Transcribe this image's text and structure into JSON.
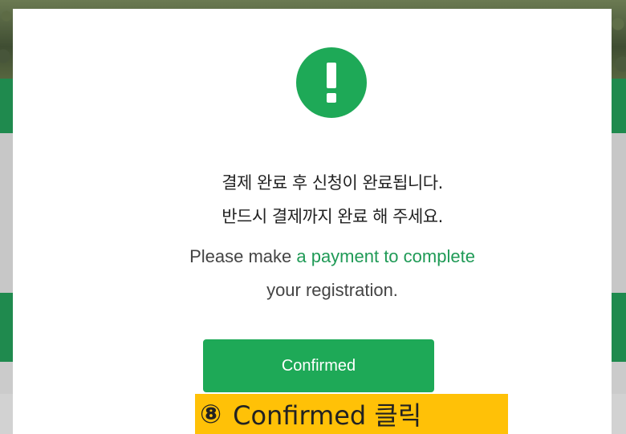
{
  "modal": {
    "icon": "exclamation-icon",
    "message_ko_line1": "결제 완료 후 신청이 완료됩니다.",
    "message_ko_line2": "반드시 결제까지 완료 해 주세요.",
    "message_en_prefix": "Please make ",
    "message_en_accent": "a payment to complete",
    "message_en_line2": "your registration.",
    "confirm_label": "Confirmed"
  },
  "annotation": {
    "step_number": "⑧",
    "instruction": "Confirmed 클릭"
  },
  "colors": {
    "accent_green": "#1ea957",
    "link_green": "#1f9a56",
    "annotation_yellow": "#ffc107"
  }
}
